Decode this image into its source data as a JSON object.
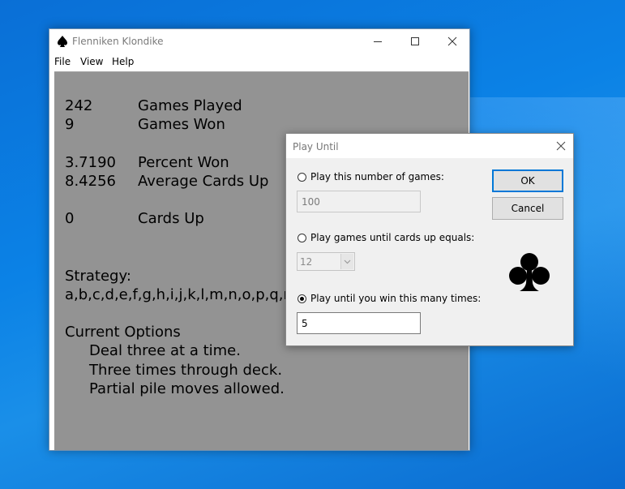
{
  "window": {
    "title": "Flenniken Klondike",
    "icon": "spade-icon"
  },
  "menu": [
    "File",
    "View",
    "Help"
  ],
  "stats": [
    {
      "value": "242",
      "label": "Games Played"
    },
    {
      "value": "9",
      "label": "Games Won"
    },
    {
      "value": "3.7190",
      "label": "Percent Won"
    },
    {
      "value": "8.4256",
      "label": "Average Cards Up"
    },
    {
      "value": "0",
      "label": "Cards Up"
    }
  ],
  "strategy": {
    "heading": "Strategy:",
    "value": "a,b,c,d,e,f,g,h,i,j,k,l,m,n,o,p,q,r"
  },
  "options": {
    "heading": "Current Options",
    "items": [
      "Deal three at a time.",
      "Three times through deck.",
      "Partial pile moves allowed."
    ]
  },
  "dialog": {
    "title": "Play Until",
    "option1": {
      "label": "Play this number of games:",
      "value": "100",
      "selected": false
    },
    "option2": {
      "label": "Play games until cards up equals:",
      "value": "12",
      "selected": false
    },
    "option3": {
      "label": "Play until you win this many times:",
      "value": "5",
      "selected": true
    },
    "ok": "OK",
    "cancel": "Cancel",
    "icon": "club-icon"
  },
  "colors": {
    "desktop": "#0b82e6",
    "client_bg": "#939393",
    "default_button_border": "#0078d7"
  }
}
